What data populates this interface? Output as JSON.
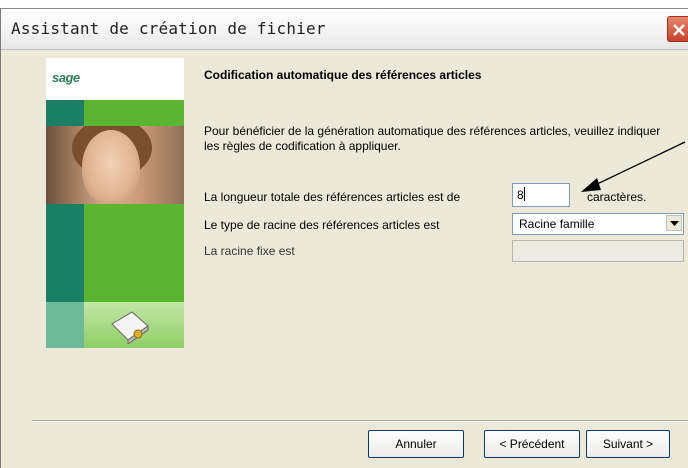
{
  "window": {
    "title": "Assistant de création de fichier"
  },
  "logo": "sage",
  "colors": {
    "green": "#5cb531",
    "teal": "#1b7f65",
    "light_green": "#a8d888",
    "sage_text": "#2e7d5b"
  },
  "page": {
    "heading": "Codification automatique des références articles",
    "description": "Pour bénéficier de la génération automatique des références articles, veuillez indiquer les règles de codification à appliquer."
  },
  "fields": {
    "length_label": "La longueur totale des références articles est de",
    "length_value": "8",
    "length_suffix": "caractères.",
    "root_type_label": "Le type de racine des références articles est",
    "root_type_value": "Racine famille",
    "fixed_root_label": "La racine fixe est",
    "fixed_root_value": ""
  },
  "buttons": {
    "cancel": "Annuler",
    "previous": "< Précédent",
    "next": "Suivant >"
  }
}
